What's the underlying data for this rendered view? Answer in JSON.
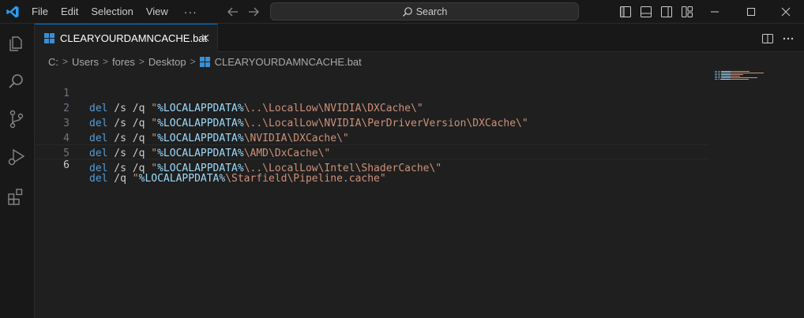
{
  "menu": [
    "File",
    "Edit",
    "Selection",
    "View"
  ],
  "menu_more": "···",
  "search": {
    "label": "Search"
  },
  "tab": {
    "label": "CLEARYOURDAMNCACHE.bat"
  },
  "breadcrumb": [
    "C:",
    "Users",
    "fores",
    "Desktop",
    "CLEARYOURDAMNCACHE.bat"
  ],
  "breadcrumb_separator": ">",
  "editor": {
    "active_line": 6,
    "lines": [
      {
        "num": "1",
        "cmd": "del",
        "opts": " /s /q ",
        "q1": "\"",
        "var": "%LOCALAPPDATA%",
        "path": "\\..\\LocalLow\\NVIDIA\\DXCache\\\""
      },
      {
        "num": "2",
        "cmd": "del",
        "opts": " /s /q ",
        "q1": "\"",
        "var": "%LOCALAPPDATA%",
        "path": "\\..\\LocalLow\\NVIDIA\\PerDriverVersion\\DXCache\\\""
      },
      {
        "num": "3",
        "cmd": "del",
        "opts": " /s /q ",
        "q1": "\"",
        "var": "%LOCALAPPDATA%",
        "path": "\\NVIDIA\\DXCache\\\""
      },
      {
        "num": "4",
        "cmd": "del",
        "opts": " /s /q ",
        "q1": "\"",
        "var": "%LOCALAPPDATA%",
        "path": "\\AMD\\DxCache\\\""
      },
      {
        "num": "5",
        "cmd": "del",
        "opts": " /s /q ",
        "q1": "\"",
        "var": "%LOCALAPPDATA%",
        "path": "\\..\\LocalLow\\Intel\\ShaderCache\\\""
      },
      {
        "num": "6",
        "cmd": "del",
        "opts": " /q ",
        "q1": "\"",
        "var": "%LOCALAPPDATA%",
        "path": "\\Starfield\\Pipeline.cache\""
      }
    ]
  },
  "colors": {
    "accent": "#0078d4",
    "keyword": "#569cd6",
    "variable": "#9cdcfe",
    "string": "#ce9178",
    "editor_bg": "#1f1f1f",
    "chrome_bg": "#181818"
  },
  "icons": {
    "app": "vscode-logo-icon",
    "back": "arrow-left-icon",
    "forward": "arrow-right-icon",
    "search": "search-icon",
    "layout": [
      "toggle-primary-sidebar-icon",
      "toggle-panel-icon",
      "toggle-secondary-sidebar-icon",
      "customize-layout-icon"
    ],
    "window": [
      "minimize-icon",
      "maximize-icon",
      "close-icon"
    ],
    "activity": [
      "explorer-icon",
      "search-icon",
      "source-control-icon",
      "run-debug-icon",
      "extensions-icon"
    ],
    "file": "windows-batch-file-icon",
    "editor_actions": [
      "split-editor-icon",
      "more-actions-icon"
    ]
  }
}
